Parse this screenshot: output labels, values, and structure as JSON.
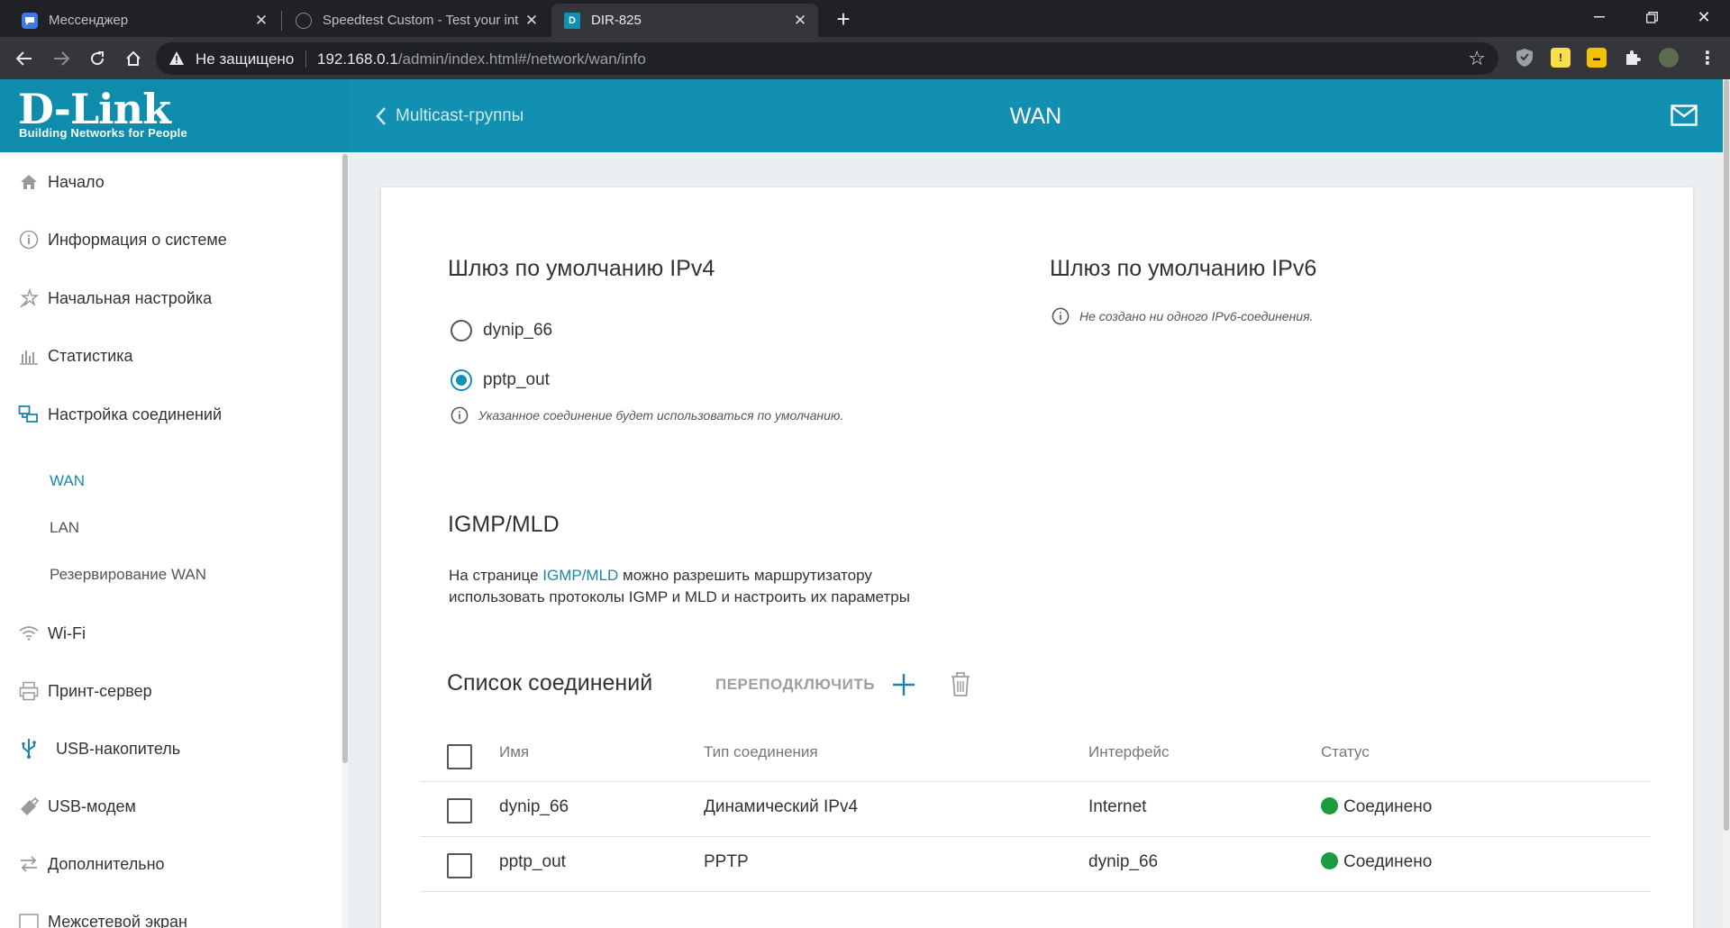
{
  "browser": {
    "tabs": [
      {
        "title": "Мессенджер"
      },
      {
        "title": "Speedtest Custom - Test your int"
      },
      {
        "title": "DIR-825"
      }
    ],
    "security_label": "Не защищено",
    "url_host": "192.168.0.1",
    "url_path": "/admin/index.html#/network/wan/info"
  },
  "brand": {
    "logo": "D-Link",
    "tagline": "Building Networks for People"
  },
  "header": {
    "back_label": "Multicast-группы",
    "title": "WAN"
  },
  "sidebar": {
    "items": [
      {
        "label": "Начало",
        "icon": "home-icon"
      },
      {
        "label": "Информация о системе",
        "icon": "info-icon"
      },
      {
        "label": "Начальная настройка",
        "icon": "wizard-icon"
      },
      {
        "label": "Статистика",
        "icon": "stats-icon"
      },
      {
        "label": "Настройка соединений",
        "icon": "connections-icon"
      },
      {
        "label": "Wi-Fi",
        "icon": "wifi-icon"
      },
      {
        "label": "Принт-сервер",
        "icon": "printer-icon"
      },
      {
        "label": "USB-накопитель",
        "icon": "usb-icon"
      },
      {
        "label": "USB-модем",
        "icon": "modem-icon"
      },
      {
        "label": "Дополнительно",
        "icon": "advanced-icon"
      },
      {
        "label": "Межсетевой экран",
        "icon": "firewall-icon"
      }
    ],
    "subitems": [
      {
        "label": "WAN",
        "active": true
      },
      {
        "label": "LAN",
        "active": false
      },
      {
        "label": "Резервирование WAN",
        "active": false
      }
    ]
  },
  "gateway_ipv4": {
    "title": "Шлюз по умолчанию IPv4",
    "options": [
      {
        "label": "dynip_66",
        "selected": false
      },
      {
        "label": "pptp_out",
        "selected": true
      }
    ],
    "hint": "Указанное соединение будет использоваться по умолчанию."
  },
  "gateway_ipv6": {
    "title": "Шлюз по умолчанию IPv6",
    "hint": "Не создано ни одного IPv6-соединения."
  },
  "igmp": {
    "title": "IGMP/MLD",
    "text_before": "На странице ",
    "link": "IGMP/MLD",
    "text_after": " можно разрешить маршрутизатору",
    "text_line2": "использовать протоколы IGMP и MLD и настроить их параметры"
  },
  "connections": {
    "title": "Список соединений",
    "reconnect_label": "ПЕРЕПОДКЛЮЧИТЬ",
    "columns": [
      "Имя",
      "Тип соединения",
      "Интерфейс",
      "Статус"
    ],
    "rows": [
      {
        "name": "dynip_66",
        "type": "Динамический IPv4",
        "interface": "Internet",
        "status": "Соединено"
      },
      {
        "name": "pptp_out",
        "type": "PPTP",
        "interface": "dynip_66",
        "status": "Соединено"
      }
    ],
    "status_color": "#1a9b3c"
  },
  "colors": {
    "brand": "#0f8bab",
    "accent": "#1290b1",
    "link": "#1b86a8"
  }
}
